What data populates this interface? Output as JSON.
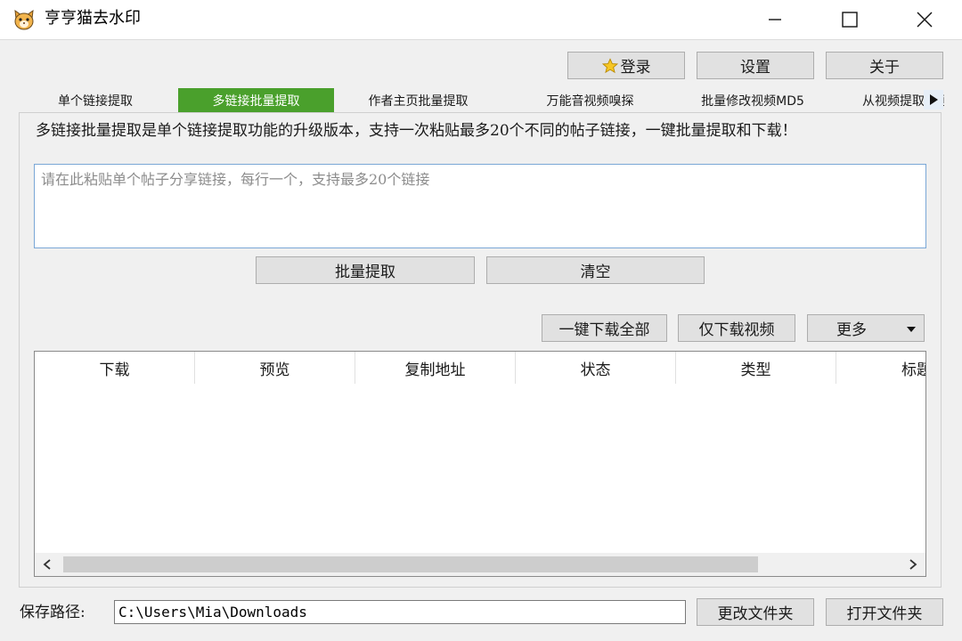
{
  "window": {
    "title": "亨亨猫去水印",
    "icon": "cat-face-icon"
  },
  "toolbar": {
    "login_label": "登录",
    "settings_label": "设置",
    "about_label": "关于"
  },
  "tabs": [
    {
      "label": "单个链接提取",
      "active": false
    },
    {
      "label": "多链接批量提取",
      "active": true
    },
    {
      "label": "作者主页批量提取",
      "active": false
    },
    {
      "label": "万能音视频嗅探",
      "active": false
    },
    {
      "label": "批量修改视频MD5",
      "active": false
    },
    {
      "label": "从视频提取音频",
      "active": false
    }
  ],
  "main": {
    "description": "多链接批量提取是单个链接提取功能的升级版本，支持一次粘贴最多20个不同的帖子链接，一键批量提取和下载！",
    "links_input": {
      "value": "",
      "placeholder": "请在此粘贴单个帖子分享链接，每行一个，支持最多20个链接"
    },
    "extract_label": "批量提取",
    "clear_label": "清空",
    "download_all_label": "一键下载全部",
    "download_video_label": "仅下载视频",
    "more_label": "更多"
  },
  "table": {
    "columns": [
      "下载",
      "预览",
      "复制地址",
      "状态",
      "类型",
      "标题"
    ],
    "rows": []
  },
  "footer": {
    "path_label": "保存路径:",
    "path_value": "C:\\Users\\Mia\\Downloads",
    "change_folder_label": "更改文件夹",
    "open_folder_label": "打开文件夹"
  },
  "colors": {
    "active_tab": "#4aa02c",
    "window_bg": "#f0f0f0",
    "button_bg": "#e1e1e1",
    "input_border": "#7aa7d6"
  }
}
